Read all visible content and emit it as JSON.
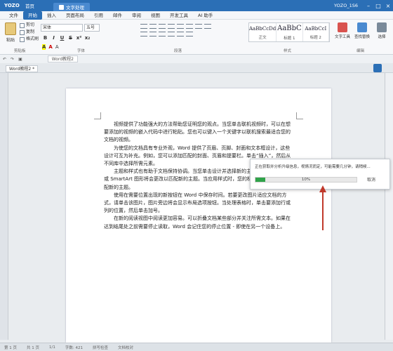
{
  "titlebar": {
    "logo": "YOZO",
    "home": "首页",
    "doc_tab": "文字处理",
    "user": "YOZO_1S6"
  },
  "menu": {
    "items": [
      "文件",
      "开始",
      "插入",
      "页面布局",
      "引用",
      "邮件",
      "审阅",
      "视图",
      "开发工具",
      "AI 助手"
    ],
    "active": "开始"
  },
  "ribbon": {
    "paste": "粘贴",
    "clipboard": [
      "剪切",
      "复制",
      "格式刷"
    ],
    "font_name": "宋体",
    "font_size": "五号",
    "styles": [
      {
        "preview": "AaBbCcDd",
        "name": "正文"
      },
      {
        "preview": "AaBbC",
        "name": "标题 1"
      },
      {
        "preview": "AaBbCcI",
        "name": "标题 2"
      }
    ],
    "tools": [
      {
        "label": "文字工具",
        "color": "#d9534f"
      },
      {
        "label": "查找替换",
        "color": "#4a8ad0"
      },
      {
        "label": "选择",
        "color": "#7a8a9a"
      }
    ],
    "groups": {
      "clipboard": "剪贴板",
      "font": "字体",
      "paragraph": "段落",
      "styles": "样式",
      "editing": "编辑"
    }
  },
  "qa": {
    "doc_tab": "Word教程2"
  },
  "docbar": {
    "tab": "Word教程2 *"
  },
  "document": {
    "paragraphs": [
      "视频提供了功能强大的方法帮助您证明您的观点。当您单击联机视频时，可以在想要添加的视频的嵌入代码中进行粘贴。您也可以键入一个关键字以联机搜索最适合您的文档的视频。",
      "为使您的文档具有专业外观，Word 提供了页眉、页脚、封面和文本框设计，这些设计可互为补充。例如，您可以添加匹配的封面、页眉和提要栏。单击“插入”，然后从不同库中选择所需元素。",
      "主题和样式也有助于文档保持协调。当您单击设计并选择新的主题时，图片、图表或 SmartArt 图形将会更改以匹配新的主题。当应用样式时，您的标题会进行更改以匹配新的主题。",
      "使用在需要位置出现的新按钮在 Word 中保存时间。若要更改图片适应文档的方式，请单击该图片，图片旁边将会显示布局选项按钮。当处理表格时，单击要添加行或列的位置，然后单击加号。",
      "在新的阅读视图中阅读更加容易。可以折叠文档某些部分并关注所需文本。如果在达到结尾处之前需要停止读取，Word 会记住您的停止位置 - 即使在另一个设备上。"
    ]
  },
  "dialog": {
    "message": "正在获取并分析升级信息，视情况而定，可能需要几分钟，请稍候...",
    "progress_text": "10%",
    "progress": 0.1,
    "cancel": "取消",
    "fill_color": "#2fa34a"
  },
  "status": [
    "第 1 页",
    "共 1 页",
    "1/1",
    "字数: 421",
    "拼写检查",
    "文档校对"
  ]
}
